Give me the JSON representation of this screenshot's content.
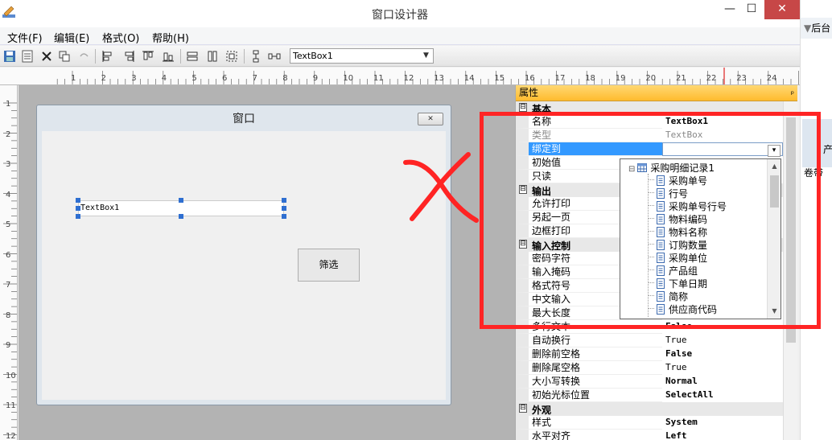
{
  "window": {
    "title": "窗口设计器",
    "min_glyph": "—",
    "max_glyph": "☐",
    "close_glyph": "✕"
  },
  "menu": {
    "items": [
      "文件(F)",
      "编辑(E)",
      "格式(O)",
      "帮助(H)"
    ]
  },
  "toolbar": {
    "control_select": "TextBox1",
    "combo_arrow": "▼"
  },
  "rulers": {
    "horizontal_labels": [
      "1",
      "2",
      "3",
      "4",
      "5",
      "6",
      "7",
      "8",
      "9",
      "10",
      "11",
      "12",
      "13",
      "14",
      "15",
      "16",
      "17",
      "18",
      "19",
      "20",
      "21",
      "22",
      "23",
      "24"
    ],
    "vertical_labels": [
      "1",
      "2",
      "3",
      "4",
      "5",
      "6",
      "7",
      "8",
      "9",
      "10",
      "11",
      "12"
    ]
  },
  "form": {
    "title": "窗口",
    "close_glyph": "✕",
    "textbox_text": "TextBox1",
    "filter_button": "筛选"
  },
  "properties": {
    "header": "属性",
    "pin_glyph": "ᵖ",
    "collapse_glyph": "⊟",
    "categories": [
      {
        "label": "基本"
      },
      {
        "label": "输出"
      },
      {
        "label": "输入控制"
      },
      {
        "label": "外观"
      }
    ],
    "rows": [
      {
        "name": "名称",
        "value": "TextBox1"
      },
      {
        "name": "类型",
        "value": "TextBox"
      },
      {
        "name": "绑定到",
        "value": ""
      },
      {
        "name": "初始值",
        "value": ""
      },
      {
        "name": "只读",
        "value": ""
      },
      {
        "name": "允许打印",
        "value": ""
      },
      {
        "name": "另起一页",
        "value": ""
      },
      {
        "name": "边框打印",
        "value": ""
      },
      {
        "name": "密码字符",
        "value": ""
      },
      {
        "name": "输入掩码",
        "value": ""
      },
      {
        "name": "格式符号",
        "value": ""
      },
      {
        "name": "中文输入",
        "value": ""
      },
      {
        "name": "最大长度",
        "value": ""
      },
      {
        "name": "多行文本",
        "value": "False"
      },
      {
        "name": "自动换行",
        "value": "True"
      },
      {
        "name": "删除前空格",
        "value": "False"
      },
      {
        "name": "删除尾空格",
        "value": "True"
      },
      {
        "name": "大小写转换",
        "value": "Normal"
      },
      {
        "name": "初始光标位置",
        "value": "SelectAll"
      },
      {
        "name": "样式",
        "value": "System"
      },
      {
        "name": "水平对齐",
        "value": "Left"
      }
    ],
    "dropdown_glyph": "▾"
  },
  "tree": {
    "root": "采购明细记录1",
    "expander": "⊟",
    "items": [
      "采购单号",
      "行号",
      "采购单号行号",
      "物料编码",
      "物料名称",
      "订购数量",
      "采购单位",
      "产品组",
      "下单日期",
      "简称",
      "供应商代码"
    ],
    "scroll_up": "▲",
    "scroll_down": "▼"
  },
  "right_edge": {
    "top_label": "后台",
    "text1": "产",
    "text2": "卷带"
  },
  "colors": {
    "annotation_red": "#ff2424",
    "selection_blue": "#3399ff",
    "header_orange": "#ffbb2e"
  }
}
